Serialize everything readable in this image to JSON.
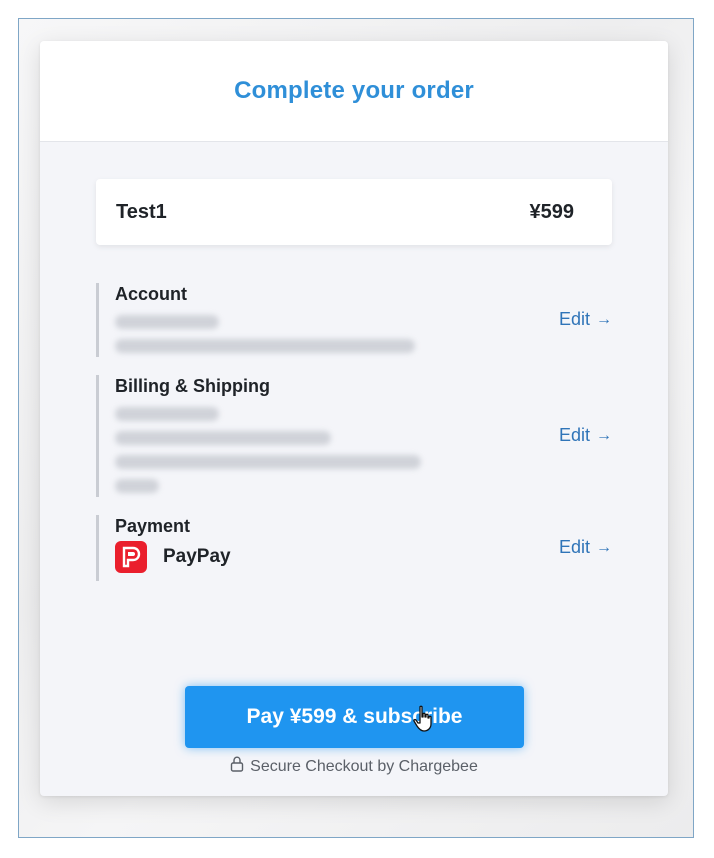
{
  "header": {
    "title": "Complete your order"
  },
  "order": {
    "item_name": "Test1",
    "item_price": "¥599"
  },
  "sections": {
    "account": {
      "title": "Account",
      "edit_label": "Edit"
    },
    "billing": {
      "title": "Billing & Shipping",
      "edit_label": "Edit"
    },
    "payment": {
      "title": "Payment",
      "method": "PayPay",
      "edit_label": "Edit"
    }
  },
  "pay_button": {
    "label": "Pay ¥599 & subscribe"
  },
  "footer": {
    "secure_text": "Secure Checkout by Chargebee"
  },
  "icons": {
    "edit_arrow": "arrow-right-icon",
    "payment_logo": "paypay-logo-icon",
    "secure": "lock-icon",
    "cursor": "hand-pointer-icon"
  },
  "colors": {
    "accent": "#2f8fd8",
    "button": "#1f95f0",
    "link": "#2f74b8",
    "paypay_red": "#ea1f2d"
  }
}
